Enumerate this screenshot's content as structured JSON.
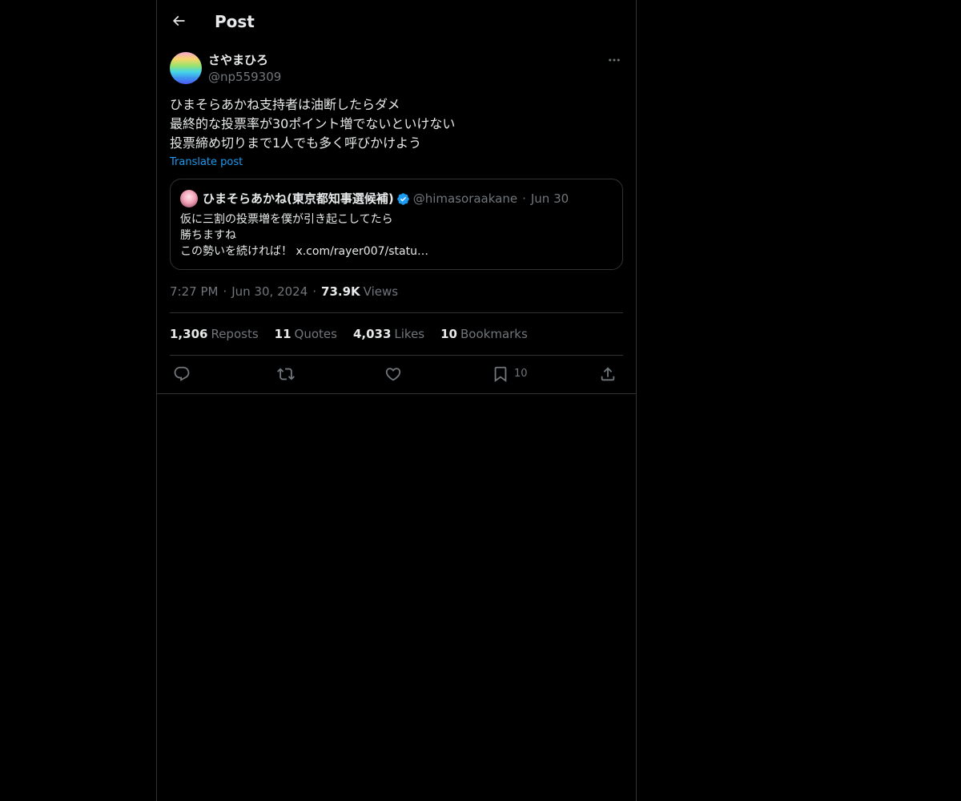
{
  "header": {
    "title": "Post",
    "back_icon": "arrow-left-icon"
  },
  "post": {
    "author": {
      "display_name": "さやまひろ",
      "handle": "@np559309"
    },
    "text_lines": [
      "ひまそらあかね支持者は油断したらダメ",
      "最終的な投票率が30ポイント増でないといけない",
      "投票締め切りまで1人でも多く呼びかけよう"
    ],
    "translate_label": "Translate post",
    "quote": {
      "display_name": "ひまそらあかね(東京都知事選候補)",
      "verified": true,
      "handle": "@himasoraakane",
      "separator": "·",
      "date": "Jun 30",
      "text_lines": [
        "仮に三割の投票増を僕が引き起こしてたら",
        "勝ちますね",
        "この勢いを続ければ！ x.com/rayer007/statu…"
      ]
    },
    "meta": {
      "time": "7:27 PM",
      "separator": "·",
      "date": "Jun 30, 2024",
      "views_count": "73.9K",
      "views_label": "Views"
    },
    "stats": {
      "reposts_count": "1,306",
      "reposts_label": "Reposts",
      "quotes_count": "11",
      "quotes_label": "Quotes",
      "likes_count": "4,033",
      "likes_label": "Likes",
      "bookmarks_count": "10",
      "bookmarks_label": "Bookmarks"
    },
    "actions": {
      "bookmark_count": "10"
    }
  },
  "colors": {
    "background": "#000000",
    "text_primary": "#e7e9ea",
    "text_secondary": "#71767b",
    "accent": "#1d9bf0",
    "border": "#2f3336"
  }
}
